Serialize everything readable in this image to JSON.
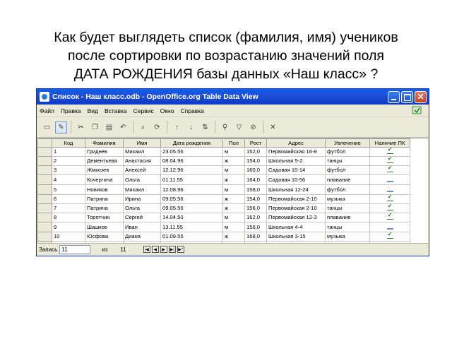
{
  "question": {
    "line1": "Как будет выглядеть список (фамилия, имя) учеников",
    "line2": "после сортировки по возрастанию значений поля",
    "line3": "ДАТА РОЖДЕНИЯ базы данных «Наш класс» ?"
  },
  "window": {
    "title": "Список - Наш класс.odb - OpenOffice.org Table Data View"
  },
  "menu": [
    {
      "label": "Файл",
      "name": "menu-file"
    },
    {
      "label": "Правка",
      "name": "menu-edit"
    },
    {
      "label": "Вид",
      "name": "menu-view"
    },
    {
      "label": "Вставка",
      "name": "menu-insert"
    },
    {
      "label": "Сервис",
      "name": "menu-tools"
    },
    {
      "label": "Окно",
      "name": "menu-window"
    },
    {
      "label": "Справка",
      "name": "menu-help"
    }
  ],
  "table": {
    "headers": [
      "Код",
      "Фамилия",
      "Имя",
      "Дата рождения",
      "Пол",
      "Рост",
      "Адрес",
      "Увлечение",
      "Наличие ПК"
    ],
    "rows": [
      {
        "code": "1",
        "last": "Гриднев",
        "first": "Михаил",
        "dob": "23.05.56",
        "sex": "м",
        "height": "152,0",
        "addr": "Первомайская 16-8",
        "hobby": "футбол",
        "pc": true
      },
      {
        "code": "2",
        "last": "Дементьева",
        "first": "Анастасия",
        "dob": "08.04.96",
        "sex": "ж",
        "height": "154,0",
        "addr": "Школьная 5-2",
        "hobby": "танцы",
        "pc": true
      },
      {
        "code": "3",
        "last": "Жмкозев",
        "first": "Алексей",
        "dob": "12.12.96",
        "sex": "м",
        "height": "160,0",
        "addr": "Садовая 10-14",
        "hobby": "футбол",
        "pc": true
      },
      {
        "code": "4",
        "last": "Кочергина",
        "first": "Ольга",
        "dob": "01.11.55",
        "sex": "ж",
        "height": "164,0",
        "addr": "Садовая 10-56",
        "hobby": "плавание",
        "pc": false
      },
      {
        "code": "5",
        "last": "Новиков",
        "first": "Михаил",
        "dob": "12.08.96",
        "sex": "м",
        "height": "158,0",
        "addr": "Школьная 12-24",
        "hobby": "футбол",
        "pc": false
      },
      {
        "code": "6",
        "last": "Патрина",
        "first": "Ирина",
        "dob": "09.05.56",
        "sex": "ж",
        "height": "154,0",
        "addr": "Первомайская 2-10",
        "hobby": "музыка",
        "pc": true
      },
      {
        "code": "7",
        "last": "Патрина",
        "first": "Ольга",
        "dob": "09.05.56",
        "sex": "ж",
        "height": "156,0",
        "addr": "Первомайская 2-10",
        "hobby": "танцы",
        "pc": true
      },
      {
        "code": "8",
        "last": "Торотчин",
        "first": "Сергей",
        "dob": "14.04.50",
        "sex": "м",
        "height": "162,0",
        "addr": "Первомайская 12-3",
        "hobby": "плавание",
        "pc": true
      },
      {
        "code": "9",
        "last": "Шашков",
        "first": "Иван",
        "dob": "13.11.55",
        "sex": "м",
        "height": "156,0",
        "addr": "Школьная 4-4",
        "hobby": "танцы",
        "pc": false
      },
      {
        "code": "10",
        "last": "Юсфова",
        "first": "Диана",
        "dob": "01.09.55",
        "sex": "ж",
        "height": "168,0",
        "addr": "Школьная 3-15",
        "hobby": "музыка",
        "pc": true
      }
    ]
  },
  "status": {
    "record_label": "Запись",
    "record_value": "11",
    "of_label": "из",
    "total": "11"
  }
}
